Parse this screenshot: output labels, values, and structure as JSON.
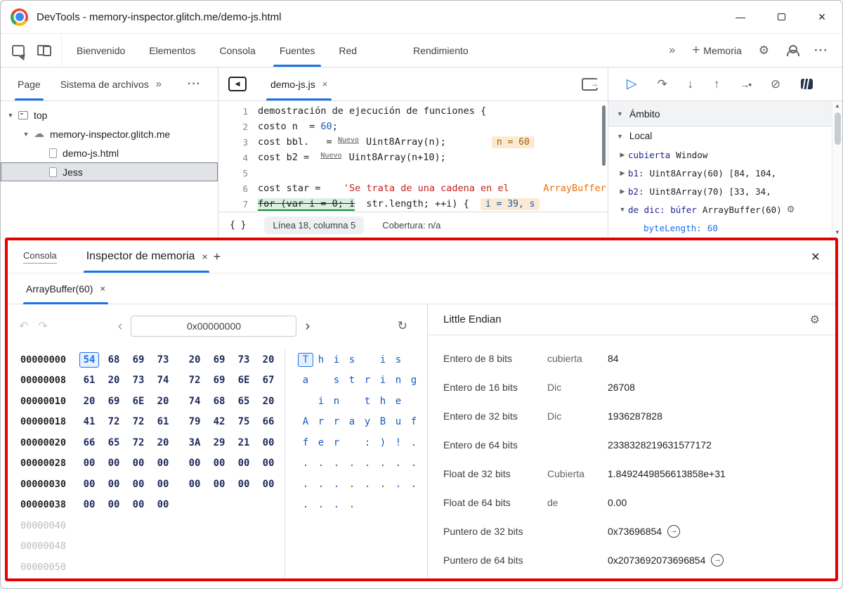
{
  "colors": {
    "accent": "#1a73e8",
    "annotation_border": "#e60000",
    "selected_byte_bg": "#e8f0fe",
    "badge_bg": "#fbead3"
  },
  "icons": {
    "minimize": "—",
    "close": "×",
    "chevrons": "»",
    "dots_h": "···",
    "plus": "+",
    "gear": "⚙",
    "resume": "▷",
    "step_over": "↷",
    "step_into": "↓",
    "step_out": "↑",
    "step": "→•",
    "deactivate_bp": "⊘",
    "undo": "↶",
    "redo": "↷",
    "back": "‹",
    "forward": "›",
    "refresh": "↻",
    "cloud": "☁",
    "collapse": "▼",
    "expand": "▶",
    "nav_back": "◀",
    "arrow_right": "→",
    "up_small": "▲",
    "down_small": "▼"
  },
  "titlebar": {
    "title": "DevTools - memory-inspector.glitch.me/demo-js.html"
  },
  "toolbar": {
    "tabs": [
      {
        "label": "Bienvenido",
        "active": false
      },
      {
        "label": "Elementos",
        "active": false
      },
      {
        "label": "Consola",
        "active": false
      },
      {
        "label": "Fuentes",
        "active": true
      },
      {
        "label": "Red",
        "active": false
      },
      {
        "label": "Rendimiento",
        "active": false,
        "gap": true
      }
    ],
    "memoria_tab": "Memoria"
  },
  "sidebar": {
    "tabs": [
      {
        "label": "Page",
        "active": true
      },
      {
        "label": "Sistema de archivos",
        "active": false
      }
    ],
    "more_chevron": "»",
    "more_dots": "···",
    "tree": [
      {
        "label": "top",
        "depth": 0,
        "expander": "▼",
        "icon": "frame"
      },
      {
        "label": "memory-inspector.glitch.me",
        "depth": 1,
        "expander": "▼",
        "icon": "cloud"
      },
      {
        "label": "demo-js.html",
        "depth": 2,
        "expander": "",
        "icon": "page"
      },
      {
        "label": "Jess",
        "depth": 2,
        "expander": "",
        "icon": "page",
        "selected": true
      }
    ]
  },
  "editor": {
    "tab": {
      "label": "demo-js.js",
      "close": "×"
    },
    "lines": [
      {
        "num": 1,
        "segs": [
          {
            "t": "demostración de ejecución de funciones {",
            "c": "tok-plain"
          }
        ]
      },
      {
        "num": 2,
        "segs": [
          {
            "t": "costo n  ",
            "c": "tok-plain"
          },
          {
            "t": "= ",
            "c": "tok-plain"
          },
          {
            "t": "60",
            "c": "tok-num"
          },
          {
            "t": ";",
            "c": "tok-plain"
          }
        ]
      },
      {
        "num": 3,
        "segs": [
          {
            "t": "cost bbl.   ",
            "c": "tok-plain"
          },
          {
            "t": "= ",
            "c": "tok-plain"
          },
          {
            "t": "Nuevo",
            "c": "tok-kw-small"
          },
          {
            "t": " Uint8Array(n);",
            "c": "tok-plain"
          },
          {
            "t": "        ",
            "c": "tok-plain"
          },
          {
            "t": "n = 60",
            "c": "badge badge-orange"
          }
        ]
      },
      {
        "num": 4,
        "segs": [
          {
            "t": "cost b2 =  ",
            "c": "tok-plain"
          },
          {
            "t": "Nuevo",
            "c": "tok-kw-small"
          },
          {
            "t": " Uint8Array(n+10);",
            "c": "tok-plain"
          }
        ]
      },
      {
        "num": 5,
        "segs": []
      },
      {
        "num": 6,
        "segs": [
          {
            "t": "cost star =    ",
            "c": "tok-plain"
          },
          {
            "t": "'Se trata de una cadena en el",
            "c": "tok-string"
          },
          {
            "t": "      ",
            "c": "tok-plain"
          },
          {
            "t": "ArrayBuffer",
            "c": "tok-string-orange"
          }
        ]
      },
      {
        "num": 7,
        "segs": [
          {
            "t": "for (var i = 0; i",
            "c": "tok-paused"
          },
          {
            "t": "  str.length; ++i) {  ",
            "c": "tok-plain"
          },
          {
            "t": "i = 39, s",
            "c": "badge badge-blue"
          }
        ]
      }
    ],
    "status": {
      "braces": "{ }",
      "position": "Línea 18, columna 5",
      "coverage": "Cobertura: n/a"
    }
  },
  "debugger": {
    "scope_header": "Ámbito",
    "local_header": "Local",
    "entries": [
      {
        "expander": "▶",
        "name": "cubierta",
        "value": "Window",
        "indent": 0
      },
      {
        "expander": "▶",
        "name": "b1:",
        "value": "Uint8Array(60) [84, 104,",
        "indent": 0
      },
      {
        "expander": "▶",
        "name": "b2:",
        "value": "Uint8Array(70) [33, 34,",
        "indent": 0
      },
      {
        "expander": "▼",
        "name": "de dic: búfer",
        "value": "ArrayBuffer(60)",
        "indent": 0,
        "icon": "memory"
      },
      {
        "expander": "",
        "name": "byteLength:",
        "value": "60",
        "indent": 1,
        "blue": true
      }
    ]
  },
  "drawer": {
    "console_tab": "Consola",
    "inspector_tab": "Inspector de memoria",
    "inspector_close": "×",
    "new_tab": "+",
    "buffer_tab": {
      "label": "ArrayBuffer(60)",
      "close": "×"
    }
  },
  "memory": {
    "address_value": "0x00000000",
    "rows": [
      {
        "addr": "00000000",
        "bytes": [
          "54",
          "68",
          "69",
          "73",
          "20",
          "69",
          "73",
          "20"
        ],
        "ascii": [
          "T",
          "h",
          "i",
          "s",
          " ",
          "i",
          "s",
          " "
        ],
        "sel": 0
      },
      {
        "addr": "00000008",
        "bytes": [
          "61",
          "20",
          "73",
          "74",
          "72",
          "69",
          "6E",
          "67"
        ],
        "ascii": [
          "a",
          " ",
          "s",
          "t",
          "r",
          "i",
          "n",
          "g"
        ]
      },
      {
        "addr": "00000010",
        "bytes": [
          "20",
          "69",
          "6E",
          "20",
          "74",
          "68",
          "65",
          "20"
        ],
        "ascii": [
          " ",
          "i",
          "n",
          " ",
          "t",
          "h",
          "e",
          " "
        ]
      },
      {
        "addr": "00000018",
        "bytes": [
          "41",
          "72",
          "72",
          "61",
          "79",
          "42",
          "75",
          "66"
        ],
        "ascii": [
          "A",
          "r",
          "r",
          "a",
          "y",
          "B",
          "u",
          "f"
        ]
      },
      {
        "addr": "00000020",
        "bytes": [
          "66",
          "65",
          "72",
          "20",
          "3A",
          "29",
          "21",
          "00"
        ],
        "ascii": [
          "f",
          "e",
          "r",
          " ",
          ":",
          ")",
          "!",
          "."
        ]
      },
      {
        "addr": "00000028",
        "bytes": [
          "00",
          "00",
          "00",
          "00",
          "00",
          "00",
          "00",
          "00"
        ],
        "ascii": [
          ".",
          ".",
          ".",
          ".",
          ".",
          ".",
          ".",
          "."
        ]
      },
      {
        "addr": "00000030",
        "bytes": [
          "00",
          "00",
          "00",
          "00",
          "00",
          "00",
          "00",
          "00"
        ],
        "ascii": [
          ".",
          ".",
          ".",
          ".",
          ".",
          ".",
          ".",
          "."
        ]
      },
      {
        "addr": "00000038",
        "bytes": [
          "00",
          "00",
          "00",
          "00"
        ],
        "ascii": [
          ".",
          ".",
          ".",
          "."
        ]
      },
      {
        "addr": "00000040",
        "bytes": [],
        "ascii": []
      },
      {
        "addr": "00000048",
        "bytes": [],
        "ascii": []
      },
      {
        "addr": "00000050",
        "bytes": [],
        "ascii": []
      }
    ]
  },
  "interpreter": {
    "endianness": "Little Endian",
    "rows": [
      {
        "label": "Entero de 8 bits",
        "mid": "cubierta",
        "value": "84"
      },
      {
        "label": "Entero de 16 bits",
        "mid": "Dic",
        "value": "26708"
      },
      {
        "label": "Entero de 32 bits",
        "mid": "Dic",
        "value": "1936287828"
      },
      {
        "label": "Entero de 64 bits",
        "mid": "",
        "value": "2338328219631577172"
      },
      {
        "label": "Float de 32 bits",
        "mid": "Cubierta",
        "value": "1.8492449856613858e+31"
      },
      {
        "label": "Float de 64 bits",
        "mid": "de",
        "value": "0.00"
      },
      {
        "label": "Puntero de 32 bits",
        "mid": "",
        "value": "0x73696854",
        "jump": true
      },
      {
        "label": "Puntero de 64 bits",
        "mid": "",
        "value": "0x2073692073696854",
        "jump": true
      }
    ]
  }
}
